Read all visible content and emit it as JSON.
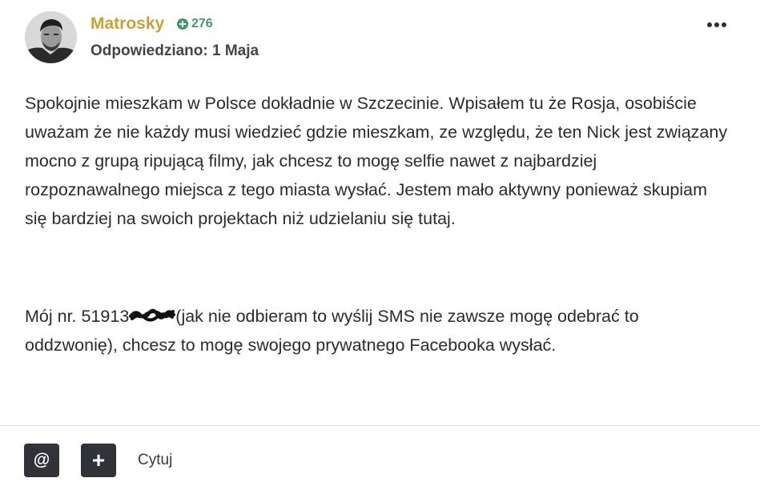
{
  "post": {
    "author": {
      "name": "Matrosky",
      "avatar_icon": "user-avatar-photo",
      "reputation_icon": "plus-circle-icon",
      "reputation": "276"
    },
    "date_text": "Odpowiedziano: 1 Maja",
    "menu_icon": "ellipsis-icon",
    "body": {
      "paragraph1": "Spokojnie mieszkam w Polsce dokładnie w Szczecinie. Wpisałem tu że Rosja, osobiście uważam że nie każdy musi wiedzieć gdzie mieszkam, ze względu, że ten Nick jest związany mocno z grupą ripującą filmy, jak chcesz to mogę selfie nawet z najbardziej rozpoznawalnego miejsca z tego miasta wysłać. Jestem mało aktywny ponieważ skupiam się bardziej na swoich projektach niż udzielaniu się tutaj.",
      "paragraph2_before": "Mój nr. 51913",
      "paragraph2_after": "(jak nie odbieram to wyślij SMS nie zawsze mogę odebrać to oddzwonię), chcesz to mogę swojego prywatnego Facebooka wysłać."
    },
    "actions": {
      "mention_label": "@",
      "add_label": "+",
      "quote_label": "Cytuj"
    }
  },
  "colors": {
    "author": "#c9a13b",
    "reputation": "#3e9a6b",
    "button_bg": "#2f3338",
    "text": "#2b2b2b"
  }
}
